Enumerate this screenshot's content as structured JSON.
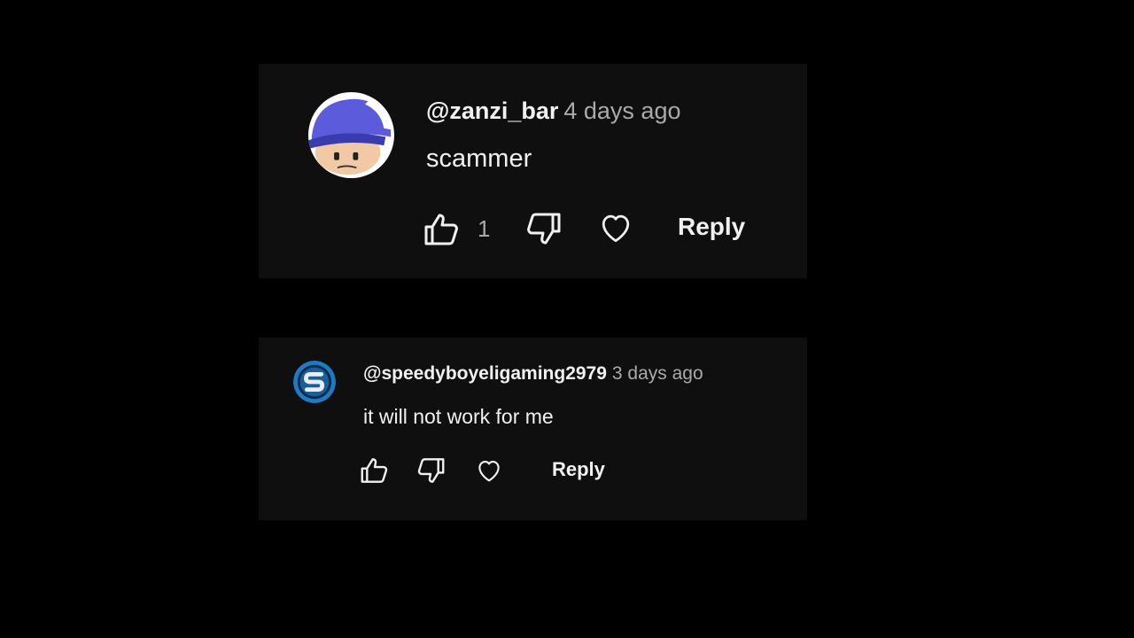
{
  "comments": [
    {
      "author": "@zanzi_bar",
      "time": "4 days ago",
      "text": "scammer",
      "likes": "1",
      "reply_label": "Reply",
      "avatar_icon": "cartoon-cap-avatar"
    },
    {
      "author": "@speedyboyeligaming2979",
      "time": "3 days ago",
      "text": "it will not work for me",
      "likes": "",
      "reply_label": "Reply",
      "avatar_icon": "s-logo-avatar"
    }
  ],
  "colors": {
    "background": "#000000",
    "card": "#0f0f0f",
    "primary_text": "#f1f1f1",
    "secondary_text": "#aaaaaa"
  }
}
